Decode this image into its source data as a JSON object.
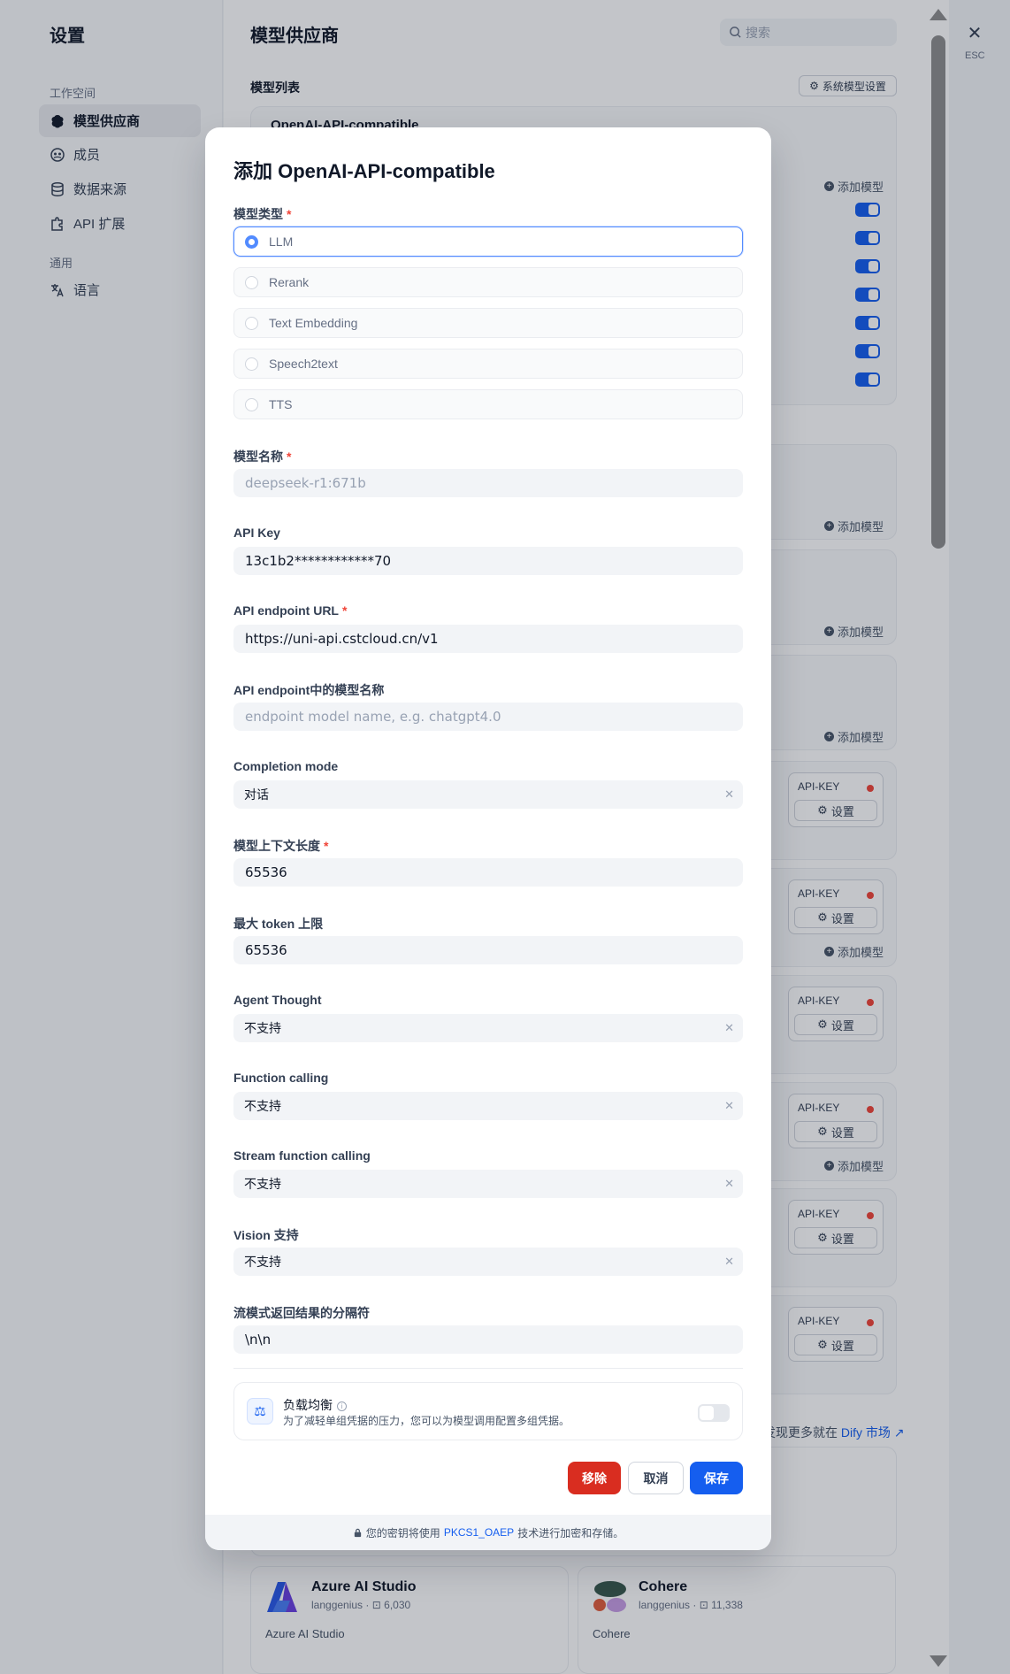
{
  "sidebar": {
    "title": "设置",
    "group_workspace": "工作空间",
    "group_general": "通用",
    "items": [
      {
        "label": "模型供应商"
      },
      {
        "label": "成员"
      },
      {
        "label": "数据来源"
      },
      {
        "label": "API 扩展"
      },
      {
        "label": "语言"
      }
    ]
  },
  "main": {
    "title": "模型供应商",
    "search_placeholder": "搜索",
    "list_title": "模型列表",
    "system_model_settings": "系统模型设置",
    "first_provider": "OpenAI-API-compatible",
    "add_model": "添加模型",
    "api_key_label": "API-KEY",
    "settings_label": "设置",
    "market_note_prefix": "发现更多就在",
    "market_link": "Dify 市场",
    "market_cards": [
      {
        "name": "Azure AI Studio",
        "author": "langgenius",
        "installs": "6,030",
        "desc": "Azure AI Studio"
      },
      {
        "name": "Cohere",
        "author": "langgenius",
        "installs": "11,338",
        "desc": "Cohere"
      }
    ]
  },
  "close": {
    "esc": "ESC"
  },
  "modal": {
    "title": "添加 OpenAI-API-compatible",
    "model_type_label": "模型类型",
    "model_types": [
      "LLM",
      "Rerank",
      "Text Embedding",
      "Speech2text",
      "TTS"
    ],
    "model_name_label": "模型名称",
    "model_name_value": "deepseek-r1:671b",
    "api_key_label": "API Key",
    "api_key_value": "13c1b2************70",
    "endpoint_label": "API endpoint URL",
    "endpoint_value": "https://uni-api.cstcloud.cn/v1",
    "endpoint_model_label": "API endpoint中的模型名称",
    "endpoint_model_placeholder": "endpoint model name, e.g. chatgpt4.0",
    "completion_mode_label": "Completion mode",
    "completion_mode_value": "对话",
    "context_length_label": "模型上下文长度",
    "context_length_value": "65536",
    "max_token_label": "最大 token 上限",
    "max_token_value": "65536",
    "agent_thought_label": "Agent Thought",
    "agent_thought_value": "不支持",
    "function_calling_label": "Function calling",
    "function_calling_value": "不支持",
    "stream_fc_label": "Stream function calling",
    "stream_fc_value": "不支持",
    "vision_label": "Vision 支持",
    "vision_value": "不支持",
    "delimiter_label": "流模式返回结果的分隔符",
    "delimiter_value": "\\n\\n",
    "load_balance_title": "负载均衡",
    "load_balance_desc": "为了减轻单组凭据的压力，您可以为模型调用配置多组凭据。",
    "remove": "移除",
    "cancel": "取消",
    "save": "保存",
    "footer_prefix": "您的密钥将使用",
    "footer_link": "PKCS1_OAEP",
    "footer_suffix": "技术进行加密和存储。"
  },
  "colors": {
    "primary": "#155eef",
    "danger": "#d92d20"
  }
}
